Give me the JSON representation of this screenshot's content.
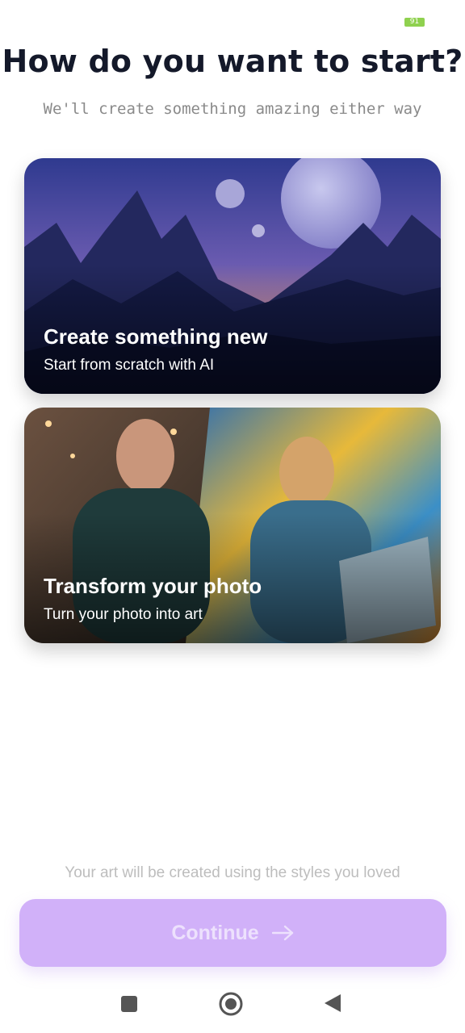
{
  "status_bar": {
    "battery_level": "91"
  },
  "header": {
    "title": "How do you want to start?",
    "subtitle": "We'll create something amazing either way"
  },
  "cards": [
    {
      "title": "Create something new",
      "subtitle": "Start from scratch with AI",
      "image": "fantasy-mountain-landscape-with-moons"
    },
    {
      "title": "Transform your photo",
      "subtitle": "Turn your photo into art",
      "image": "man-at-laptop-photo-and-painting"
    }
  ],
  "footer": {
    "note": "Your art will be created using the styles you loved",
    "continue_label": "Continue",
    "continue_icon": "arrow-right-icon"
  },
  "nav": [
    "recents-square-icon",
    "home-circle-icon",
    "back-triangle-icon"
  ],
  "colors": {
    "title": "#14192a",
    "button_bg": "#d1b1f9",
    "button_text": "#ede1fd",
    "battery": "#8fd14f"
  }
}
